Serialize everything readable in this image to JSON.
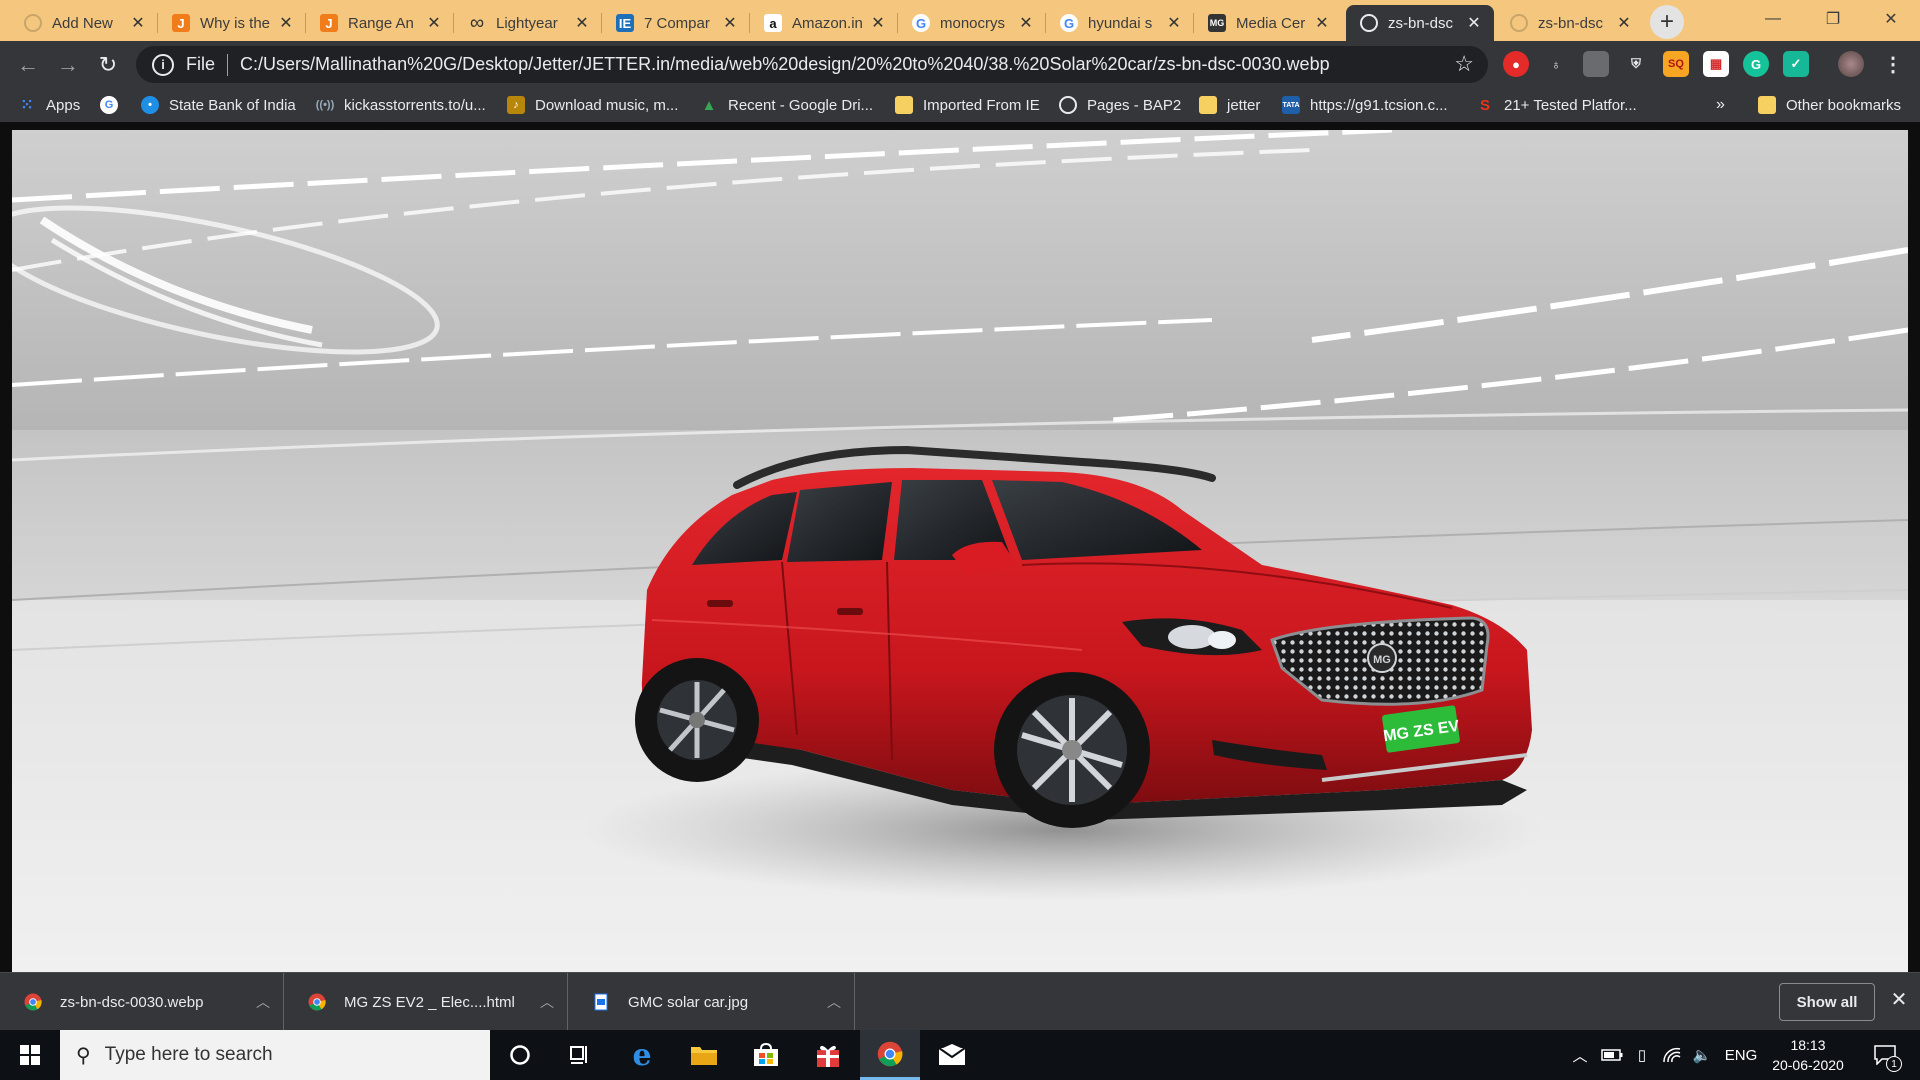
{
  "tabs": [
    {
      "title": "Add New",
      "favicon": "page-icon",
      "active": false
    },
    {
      "title": "Why is the",
      "favicon": "jetter-icon",
      "active": false
    },
    {
      "title": "Range An",
      "favicon": "jetter-icon",
      "active": false
    },
    {
      "title": "Lightyear",
      "favicon": "infinity-icon",
      "active": false
    },
    {
      "title": "7 Compar",
      "favicon": "ie-icon",
      "active": false
    },
    {
      "title": "Amazon.in",
      "favicon": "amazon-icon",
      "active": false
    },
    {
      "title": "monocrys",
      "favicon": "google-icon",
      "active": false
    },
    {
      "title": "hyundai s",
      "favicon": "google-icon",
      "active": false
    },
    {
      "title": "Media Cer",
      "favicon": "mg-icon",
      "active": false
    },
    {
      "title": "zs-bn-dsc",
      "favicon": "globe-icon",
      "active": true
    },
    {
      "title": "zs-bn-dsc",
      "favicon": "page-icon",
      "active": false
    }
  ],
  "newtab_label": "+",
  "toolbar": {
    "scheme": "File",
    "url": "C:/Users/Mallinathan%20G/Desktop/Jetter/JETTER.in/media/web%20design/20%20to%2040/38.%20Solar%20car/zs-bn-dsc-0030.webp"
  },
  "bookmarks": [
    {
      "label": "Apps",
      "icon": "apps-grid-icon"
    },
    {
      "label": "",
      "icon": "google-icon"
    },
    {
      "label": "State Bank of India",
      "icon": "sbi-icon"
    },
    {
      "label": "kickasstorrents.to/u...",
      "icon": "kat-icon"
    },
    {
      "label": "Download music, m...",
      "icon": "music-icon"
    },
    {
      "label": "Recent - Google Dri...",
      "icon": "drive-icon"
    },
    {
      "label": "Imported From IE",
      "icon": "folder-icon"
    },
    {
      "label": "Pages - BAP2",
      "icon": "globe-icon"
    },
    {
      "label": "jetter",
      "icon": "folder-icon"
    },
    {
      "label": "https://g91.tcsion.c...",
      "icon": "tata-icon"
    },
    {
      "label": "21+ Tested Platfor...",
      "icon": "semrush-icon"
    }
  ],
  "bookmarks_overflow": "»",
  "other_bookmarks": "Other bookmarks",
  "image": {
    "plate_text": "MG ZS EV",
    "body_color": "#c8161d"
  },
  "downloads": [
    {
      "name": "zs-bn-dsc-0030.webp",
      "icon": "chrome-icon"
    },
    {
      "name": "MG ZS EV2 _ Elec....html",
      "icon": "chrome-icon"
    },
    {
      "name": "GMC solar car.jpg",
      "icon": "image-file-icon"
    }
  ],
  "show_all": "Show all",
  "taskbar": {
    "search_placeholder": "Type here to search",
    "language": "ENG",
    "time": "18:13",
    "date": "20-06-2020",
    "notification_count": "1"
  }
}
